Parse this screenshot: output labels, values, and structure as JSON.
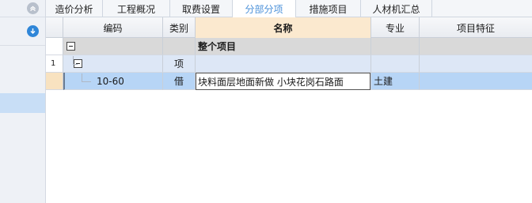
{
  "tabs": [
    {
      "label": "造价分析",
      "active": false
    },
    {
      "label": "工程概况",
      "active": false
    },
    {
      "label": "取费设置",
      "active": false
    },
    {
      "label": "分部分项",
      "active": true
    },
    {
      "label": "措施项目",
      "active": false
    },
    {
      "label": "人材机汇总",
      "active": false
    }
  ],
  "columns": {
    "code": "编码",
    "category": "类别",
    "name": "名称",
    "specialty": "专业",
    "feature": "项目特征"
  },
  "rows": {
    "project": {
      "name": "整个项目"
    },
    "item": {
      "number": "1",
      "category": "项"
    },
    "sub": {
      "code": "10-60",
      "category": "借",
      "name": "块料面层地面新做 小块花岗石路面",
      "specialty": "土建"
    }
  },
  "colors": {
    "accent": "#4a90d9",
    "selected_row": "#b7d5f6",
    "selected_header": "#fbe9cf"
  },
  "icons": {
    "collapse": "chevron-up-icon",
    "download": "arrow-down-icon",
    "toggle": "collapse-minus-icon"
  }
}
